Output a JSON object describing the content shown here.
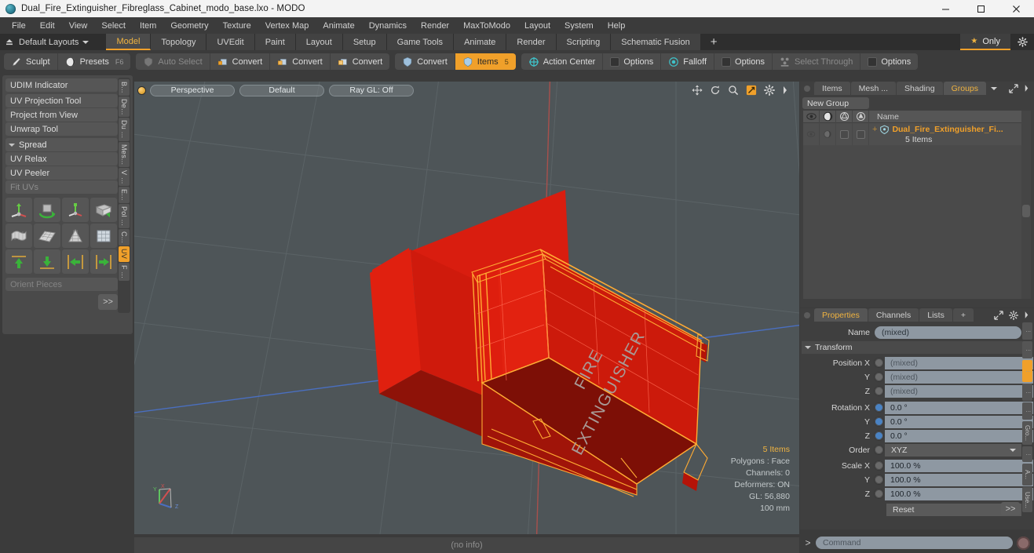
{
  "window": {
    "title": "Dual_Fire_Extinguisher_Fibreglass_Cabinet_modo_base.lxo - MODO",
    "app_icon": "modo-app-icon",
    "minimize": "—",
    "maximize": "❐",
    "close": "✕"
  },
  "menubar": {
    "items": [
      "File",
      "Edit",
      "View",
      "Select",
      "Item",
      "Geometry",
      "Texture",
      "Vertex Map",
      "Animate",
      "Dynamics",
      "Render",
      "MaxToModo",
      "Layout",
      "System",
      "Help"
    ]
  },
  "layoutbar": {
    "layouts_label": "Default Layouts",
    "tabs": [
      {
        "label": "Model",
        "active": true
      },
      {
        "label": "Topology",
        "active": false
      },
      {
        "label": "UVEdit",
        "active": false
      },
      {
        "label": "Paint",
        "active": false
      },
      {
        "label": "Layout",
        "active": false
      },
      {
        "label": "Setup",
        "active": false
      },
      {
        "label": "Game Tools",
        "active": false
      },
      {
        "label": "Animate",
        "active": false
      },
      {
        "label": "Render",
        "active": false
      },
      {
        "label": "Scripting",
        "active": false
      },
      {
        "label": "Schematic Fusion",
        "active": false
      }
    ],
    "add_tab": "+",
    "only_label": "Only",
    "only_icon": "star-icon",
    "settings_icon": "gear-icon"
  },
  "toolbar": {
    "group1": [
      {
        "label": "Sculpt",
        "icon": "brush-icon",
        "shortcut": "",
        "state": "normal"
      },
      {
        "label": "Presets",
        "icon": "sphere-icon",
        "shortcut": "F6",
        "state": "normal"
      }
    ],
    "group2": [
      {
        "label": "Auto Select",
        "icon": "shield-grey-icon",
        "state": "disabled"
      },
      {
        "label": "Convert",
        "icon": "vertex-convert-icon",
        "state": "normal"
      },
      {
        "label": "Convert",
        "icon": "edge-convert-icon",
        "state": "normal"
      },
      {
        "label": "Convert",
        "icon": "polygon-convert-icon",
        "state": "normal"
      }
    ],
    "group3": [
      {
        "label": "Convert",
        "icon": "material-convert-icon",
        "state": "normal"
      },
      {
        "label": "Items",
        "icon": "items-icon",
        "shortcut": "5",
        "state": "active"
      }
    ],
    "group4": [
      {
        "label": "Action Center",
        "icon": "crosshair-icon",
        "state": "normal"
      },
      {
        "label": "Options",
        "icon": "checkbox-icon",
        "state": "normal"
      },
      {
        "label": "Falloff",
        "icon": "falloff-icon",
        "state": "normal"
      },
      {
        "label": "Options",
        "icon": "checkbox-icon",
        "state": "normal"
      },
      {
        "label": "Select Through",
        "icon": "select-through-icon",
        "state": "disabled"
      },
      {
        "label": "Options",
        "icon": "checkbox-icon",
        "state": "normal"
      }
    ]
  },
  "left_panel": {
    "rows": [
      {
        "label": "UDIM Indicator",
        "type": "button",
        "state": "normal"
      },
      {
        "label": "UV Projection Tool",
        "type": "button",
        "state": "normal"
      },
      {
        "label": "Project from View",
        "type": "button",
        "state": "normal"
      },
      {
        "label": "Unwrap Tool",
        "type": "button",
        "state": "normal"
      },
      {
        "label": "Spread",
        "type": "section",
        "state": "normal"
      },
      {
        "label": "UV Relax",
        "type": "button",
        "state": "normal"
      },
      {
        "label": "UV Peeler",
        "type": "button",
        "state": "normal"
      },
      {
        "label": "Fit UVs",
        "type": "button",
        "state": "disabled"
      }
    ],
    "grid_icons": [
      "uv-move-icon",
      "uv-rotate-icon",
      "uv-scale-icon",
      "uv-flip-icon",
      "uv-fit-icon",
      "uv-grid-icon",
      "uv-cone-icon",
      "uv-cube-icon",
      "align-up-icon",
      "align-down-icon",
      "align-left-icon",
      "align-right-icon"
    ],
    "orient_pieces": "Orient Pieces",
    "more_button": ">>",
    "vtabs": [
      {
        "label": "B...",
        "active": false
      },
      {
        "label": "De...",
        "active": false
      },
      {
        "label": "Du ...",
        "active": false
      },
      {
        "label": "Mes...",
        "active": false
      },
      {
        "label": "V ...",
        "active": false
      },
      {
        "label": "E...",
        "active": false
      },
      {
        "label": "Pol ...",
        "active": false
      },
      {
        "label": "C...",
        "active": false
      },
      {
        "label": "UV",
        "active": true
      },
      {
        "label": "F ...",
        "active": false
      }
    ]
  },
  "viewport": {
    "view_mode": "Perspective",
    "shading_mode": "Default",
    "raygl": "Ray GL: Off",
    "nav_icons": [
      "pan-icon",
      "rotate-icon",
      "zoom-icon",
      "fit-icon",
      "gear-icon",
      "chevron-right-icon"
    ],
    "info": {
      "items": "5 Items",
      "polygons": "Polygons : Face",
      "channels": "Channels: 0",
      "deformers": "Deformers: ON",
      "gl": "GL: 56,880",
      "scale": "100 mm"
    },
    "model_label": "FIRE EXTINGUISHER",
    "status": "(no info)",
    "colors": {
      "background": "#4e5558",
      "mesh_fill": "#d01b0f",
      "mesh_wire": "#ffab33",
      "axis_x": "#c0504d",
      "axis_z": "#4a6fc0"
    }
  },
  "groups_panel": {
    "tabs": [
      {
        "label": "Items",
        "active": false
      },
      {
        "label": "Mesh ...",
        "active": false
      },
      {
        "label": "Shading",
        "active": false
      },
      {
        "label": "Groups",
        "active": true
      }
    ],
    "caret": "chevron-down-icon",
    "expand_icon": "expand-icon",
    "more_icon": "chevron-right-icon",
    "new_group_button": "New Group",
    "columns": [
      "eye-icon",
      "render-icon",
      "wire-icon",
      "shade-icon",
      "Name"
    ],
    "rows": [
      {
        "name": "Dual_Fire_Extinguisher_Fi...",
        "subtitle": "5 Items",
        "icon": "group-icon",
        "expander": "+"
      }
    ]
  },
  "properties_panel": {
    "tabs": [
      {
        "label": "Properties",
        "active": true
      },
      {
        "label": "Channels",
        "active": false
      },
      {
        "label": "Lists",
        "active": false
      }
    ],
    "add_tab": "+",
    "expand_icon": "expand-icon",
    "gear_icon": "gear-icon",
    "more_icon": "chevron-right-icon",
    "name_label": "Name",
    "name_value": "(mixed)",
    "transform_section": "Transform",
    "fields": [
      {
        "label": "Position X",
        "value": "(mixed)",
        "radio": "grey",
        "placeholder": true
      },
      {
        "label": "Y",
        "value": "(mixed)",
        "radio": "grey",
        "placeholder": true
      },
      {
        "label": "Z",
        "value": "(mixed)",
        "radio": "grey",
        "placeholder": true
      },
      {
        "label": "Rotation X",
        "value": "0.0 °",
        "radio": "blue",
        "placeholder": false
      },
      {
        "label": "Y",
        "value": "0.0 °",
        "radio": "blue",
        "placeholder": false
      },
      {
        "label": "Z",
        "value": "0.0 °",
        "radio": "blue",
        "placeholder": false
      }
    ],
    "order_label": "Order",
    "order_value": "XYZ",
    "scale_fields": [
      {
        "label": "Scale X",
        "value": "100.0 %",
        "radio": "grey"
      },
      {
        "label": "Y",
        "value": "100.0 %",
        "radio": "grey"
      },
      {
        "label": "Z",
        "value": "100.0 %",
        "radio": "grey"
      }
    ],
    "reset_value": "Reset",
    "more_button": ">>",
    "vtabs": [
      {
        "label": "",
        "active": false
      },
      {
        "label": "",
        "active": false
      },
      {
        "label": "",
        "active": true
      },
      {
        "label": "",
        "active": false
      },
      {
        "label": "",
        "active": false
      },
      {
        "label": "Gro...",
        "active": false
      },
      {
        "label": "",
        "active": false
      },
      {
        "label": "A...",
        "active": false
      },
      {
        "label": "Use...",
        "active": false
      }
    ]
  },
  "command_bar": {
    "prompt": ">",
    "placeholder": "Command",
    "record_icon": "record-icon"
  }
}
